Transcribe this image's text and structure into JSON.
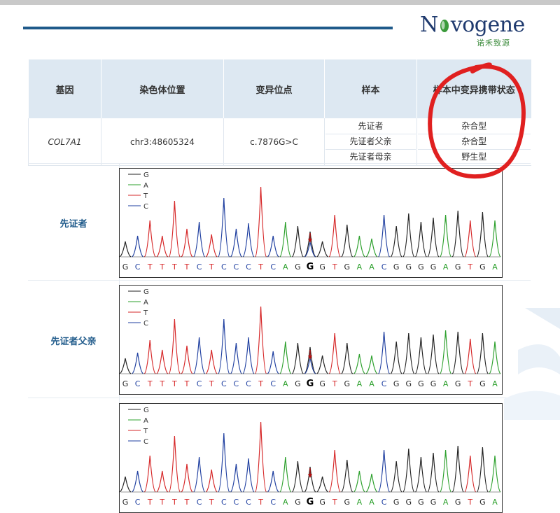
{
  "brand": {
    "logo_text": "Novogene",
    "logo_cn": "诺禾致源"
  },
  "table": {
    "headers": [
      "基因",
      "染色体位置",
      "变异位点",
      "样本",
      "样本中变异携带状态"
    ],
    "gene": "COL7A1",
    "position": "chr3:48605324",
    "variant": "c.7876G>C",
    "samples": [
      "先证者",
      "先证者父亲",
      "先证者母亲"
    ],
    "statuses": [
      "杂合型",
      "杂合型",
      "野生型"
    ]
  },
  "legend": [
    {
      "base": "G",
      "color": "#222222"
    },
    {
      "base": "A",
      "color": "#2ca02c"
    },
    {
      "base": "T",
      "color": "#d62728"
    },
    {
      "base": "C",
      "color": "#1f3fa0"
    }
  ],
  "sequence": "GCTTTTCTCCCTCAGGGTGAACGGGGAGTGA",
  "variant_index": 15,
  "rows": [
    {
      "label": "先证者"
    },
    {
      "label": "先证者父亲"
    },
    {
      "label": "先证者母亲"
    }
  ],
  "colors": {
    "header_bg": "#dde8f2",
    "accent": "#1f5a8a",
    "annotation": "#e02020",
    "arrow": "#b01010"
  }
}
